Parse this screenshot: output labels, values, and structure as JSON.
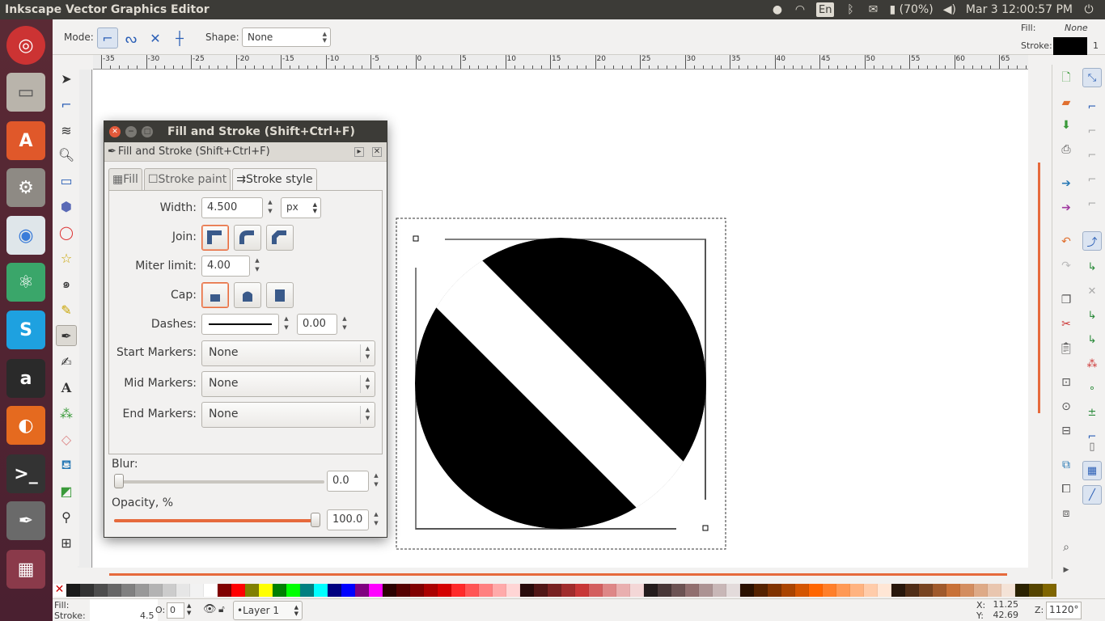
{
  "topbar": {
    "title": "Inkscape Vector Graphics Editor",
    "lang": "En",
    "battery": "(70%)",
    "datetime": "Mar 3 12:00:57 PM"
  },
  "toolcontrols": {
    "mode_label": "Mode:",
    "shape_label": "Shape:",
    "shape_value": "None",
    "fill_label": "Fill:",
    "fill_value": "None",
    "stroke_label": "Stroke:",
    "stroke_width": "1"
  },
  "ruler": {
    "labels": [
      "-35",
      "-30",
      "-25",
      "-20",
      "-15",
      "-10",
      "-5",
      "0",
      "5",
      "10",
      "15",
      "20",
      "25",
      "30",
      "35",
      "40",
      "45",
      "50",
      "55",
      "60",
      "65"
    ]
  },
  "dialog": {
    "title": "Fill and Stroke (Shift+Ctrl+F)",
    "subtitle": "Fill and Stroke (Shift+Ctrl+F)",
    "tabs": [
      "Fill",
      "Stroke paint",
      "Stroke style"
    ],
    "width_label": "Width:",
    "width_value": "4.500",
    "unit": "px",
    "join_label": "Join:",
    "miter_label": "Miter limit:",
    "miter_value": "4.00",
    "cap_label": "Cap:",
    "dashes_label": "Dashes:",
    "dash_offset": "0.00",
    "start_markers_label": "Start Markers:",
    "start_markers_value": "None",
    "mid_markers_label": "Mid Markers:",
    "mid_markers_value": "None",
    "end_markers_label": "End Markers:",
    "end_markers_value": "None",
    "blur_label": "Blur:",
    "blur_value": "0.0",
    "blur_fraction": 0.0,
    "opacity_label": "Opacity, %",
    "opacity_value": "100.0",
    "opacity_fraction": 1.0
  },
  "statusbar": {
    "fill_label": "Fill:",
    "stroke_label": "Stroke:",
    "stroke_width": "4.5",
    "o_label": "O:",
    "o_value": "0",
    "layer": "•Layer 1",
    "x_label": "X:",
    "x_value": "11.25",
    "y_label": "Y:",
    "y_value": "42.69",
    "z_label": "Z:",
    "zoom": "1120°"
  },
  "palette": [
    "#1a1a1a",
    "#333333",
    "#4d4d4d",
    "#666666",
    "#808080",
    "#999999",
    "#b3b3b3",
    "#cccccc",
    "#e6e6e6",
    "#f2f2f2",
    "#ffffff",
    "#800000",
    "#ff0000",
    "#808000",
    "#ffff00",
    "#008000",
    "#00ff00",
    "#008080",
    "#00ffff",
    "#000080",
    "#0000ff",
    "#800080",
    "#ff00ff",
    "#2b0000",
    "#550000",
    "#800000",
    "#aa0000",
    "#d40000",
    "#ff2a2a",
    "#ff5555",
    "#ff8080",
    "#ffaaaa",
    "#ffd5d5",
    "#280b0b",
    "#501616",
    "#782121",
    "#a02c2c",
    "#c83737",
    "#d35f5f",
    "#de8787",
    "#e9afaf",
    "#f4d7d7",
    "#241c1c",
    "#483737",
    "#6c5353",
    "#916f6f",
    "#ac9393",
    "#c8b7b7",
    "#e3dbdb",
    "#2b1100",
    "#552200",
    "#803300",
    "#aa4400",
    "#d45500",
    "#ff6600",
    "#ff7f2a",
    "#ff9955",
    "#ffb380",
    "#ffccaa",
    "#ffe6d5",
    "#28170b",
    "#502d16",
    "#784421",
    "#a05a2c",
    "#c87137",
    "#d38d5f",
    "#deaa87",
    "#e9c6af",
    "#f4e3d7",
    "#2b2200",
    "#554400",
    "#806600"
  ],
  "colors": {
    "accent": "#e66a3c",
    "titlebar": "#3c3b37",
    "launcher": "#4a2030"
  }
}
